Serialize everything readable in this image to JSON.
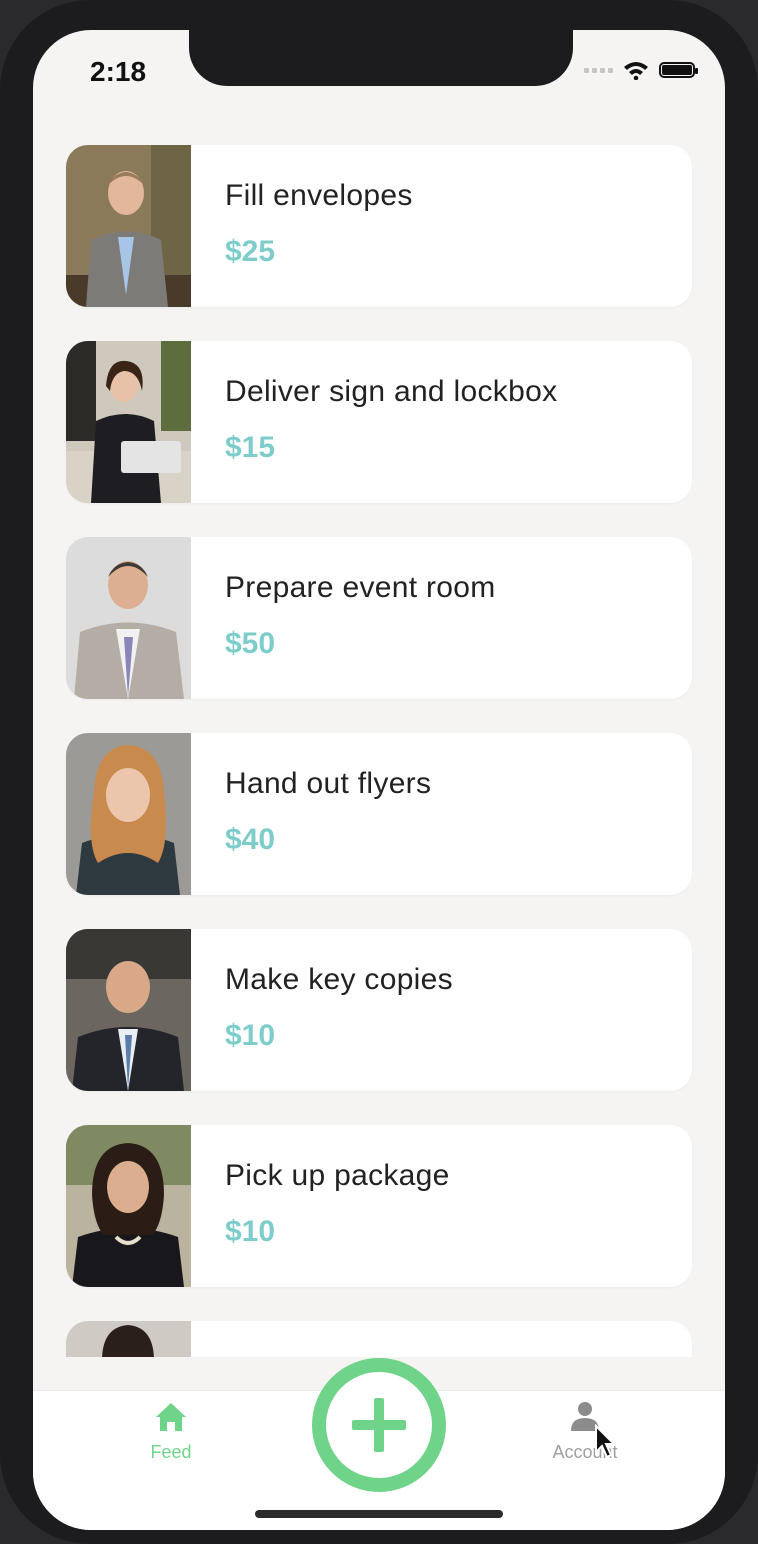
{
  "status": {
    "time": "2:18"
  },
  "tasks": [
    {
      "title": "Fill envelopes",
      "price": "$25"
    },
    {
      "title": "Deliver sign and lockbox",
      "price": "$15"
    },
    {
      "title": "Prepare event room",
      "price": "$50"
    },
    {
      "title": "Hand out flyers",
      "price": "$40"
    },
    {
      "title": "Make key copies",
      "price": "$10"
    },
    {
      "title": "Pick up package",
      "price": "$10"
    }
  ],
  "tabbar": {
    "feed_label": "Feed",
    "account_label": "Account"
  },
  "colors": {
    "accent_green": "#6fd389",
    "price_teal": "#7fcdcb",
    "background": "#f5f4f2"
  },
  "icons": {
    "feed": "home-icon",
    "add": "plus-icon",
    "account": "person-icon"
  }
}
